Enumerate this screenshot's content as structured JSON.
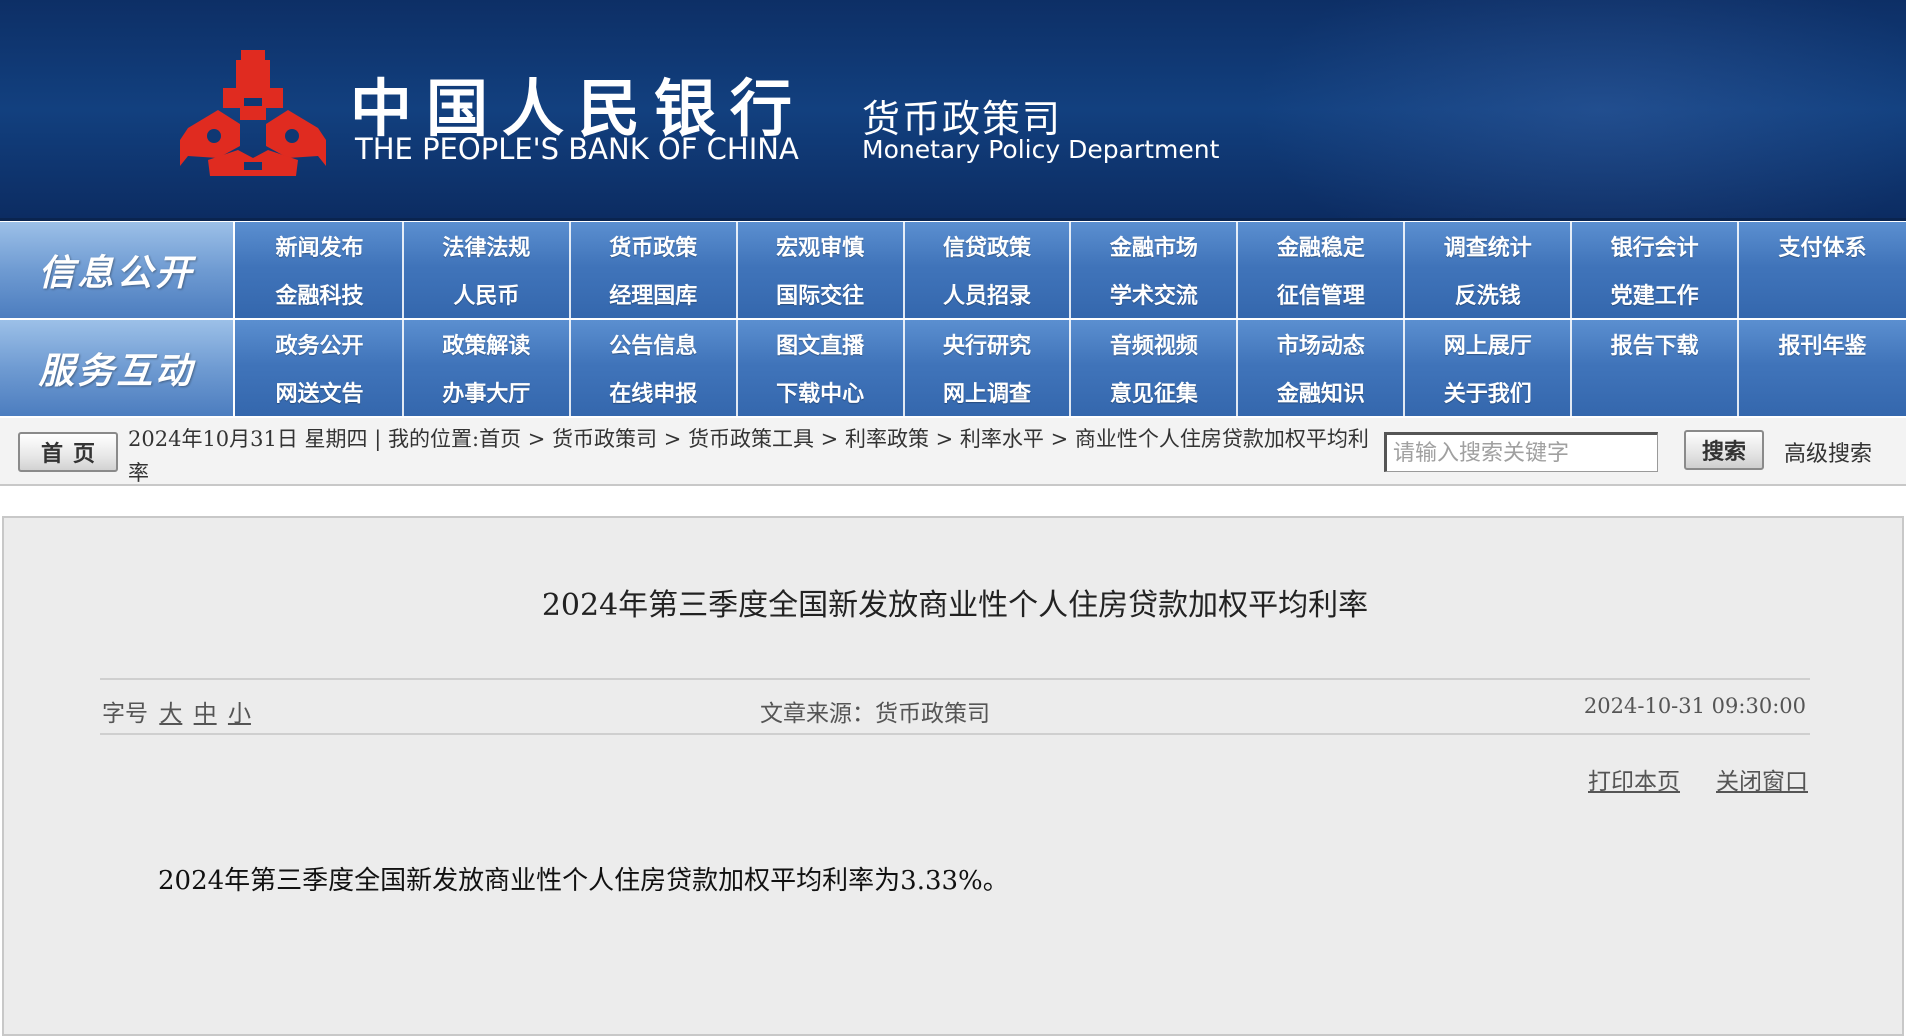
{
  "header": {
    "bank_name_cn": "中国人民银行",
    "bank_name_en": "THE PEOPLE'S BANK OF CHINA",
    "dept_name_cn": "货币政策司",
    "dept_name_en": "Monetary Policy Department",
    "logo_icon": "pboc-emblem-icon",
    "background_color": "#0f3873",
    "emblem_color": "#e02b20"
  },
  "nav_info": {
    "label": "信息公开",
    "items": [
      "新闻发布",
      "法律法规",
      "货币政策",
      "宏观审慎",
      "信贷政策",
      "金融市场",
      "金融稳定",
      "调查统计",
      "银行会计",
      "支付体系",
      "金融科技",
      "人民币",
      "经理国库",
      "国际交往",
      "人员招录",
      "学术交流",
      "征信管理",
      "反洗钱",
      "党建工作",
      ""
    ]
  },
  "nav_service": {
    "label": "服务互动",
    "items": [
      "政务公开",
      "政策解读",
      "公告信息",
      "图文直播",
      "央行研究",
      "音频视频",
      "市场动态",
      "网上展厅",
      "报告下载",
      "报刊年鉴",
      "网送文告",
      "办事大厅",
      "在线申报",
      "下载中心",
      "网上调查",
      "意见征集",
      "金融知识",
      "关于我们",
      "",
      ""
    ]
  },
  "crumbbar": {
    "home_label": "首页",
    "date": "2024年10月31日 星期四",
    "separator": "|",
    "location_prefix": "我的位置:",
    "path": [
      "首页",
      "货币政策司",
      "货币政策工具",
      "利率政策",
      "利率水平",
      "商业性个人住房贷款加权平均利率"
    ],
    "path_sep": " > ",
    "search_placeholder": "请输入搜索关键字",
    "search_button": "搜索",
    "advanced_search": "高级搜索"
  },
  "article": {
    "title": "2024年第三季度全国新发放商业性个人住房贷款加权平均利率",
    "font_size_label": "字号",
    "font_sizes": [
      "大",
      "中",
      "小"
    ],
    "source_label": "文章来源：",
    "source": "货币政策司",
    "timestamp": "2024-10-31 09:30:00",
    "print_label": "打印本页",
    "close_label": "关闭窗口",
    "body": "2024年第三季度全国新发放商业性个人住房贷款加权平均利率为3.33%。"
  }
}
